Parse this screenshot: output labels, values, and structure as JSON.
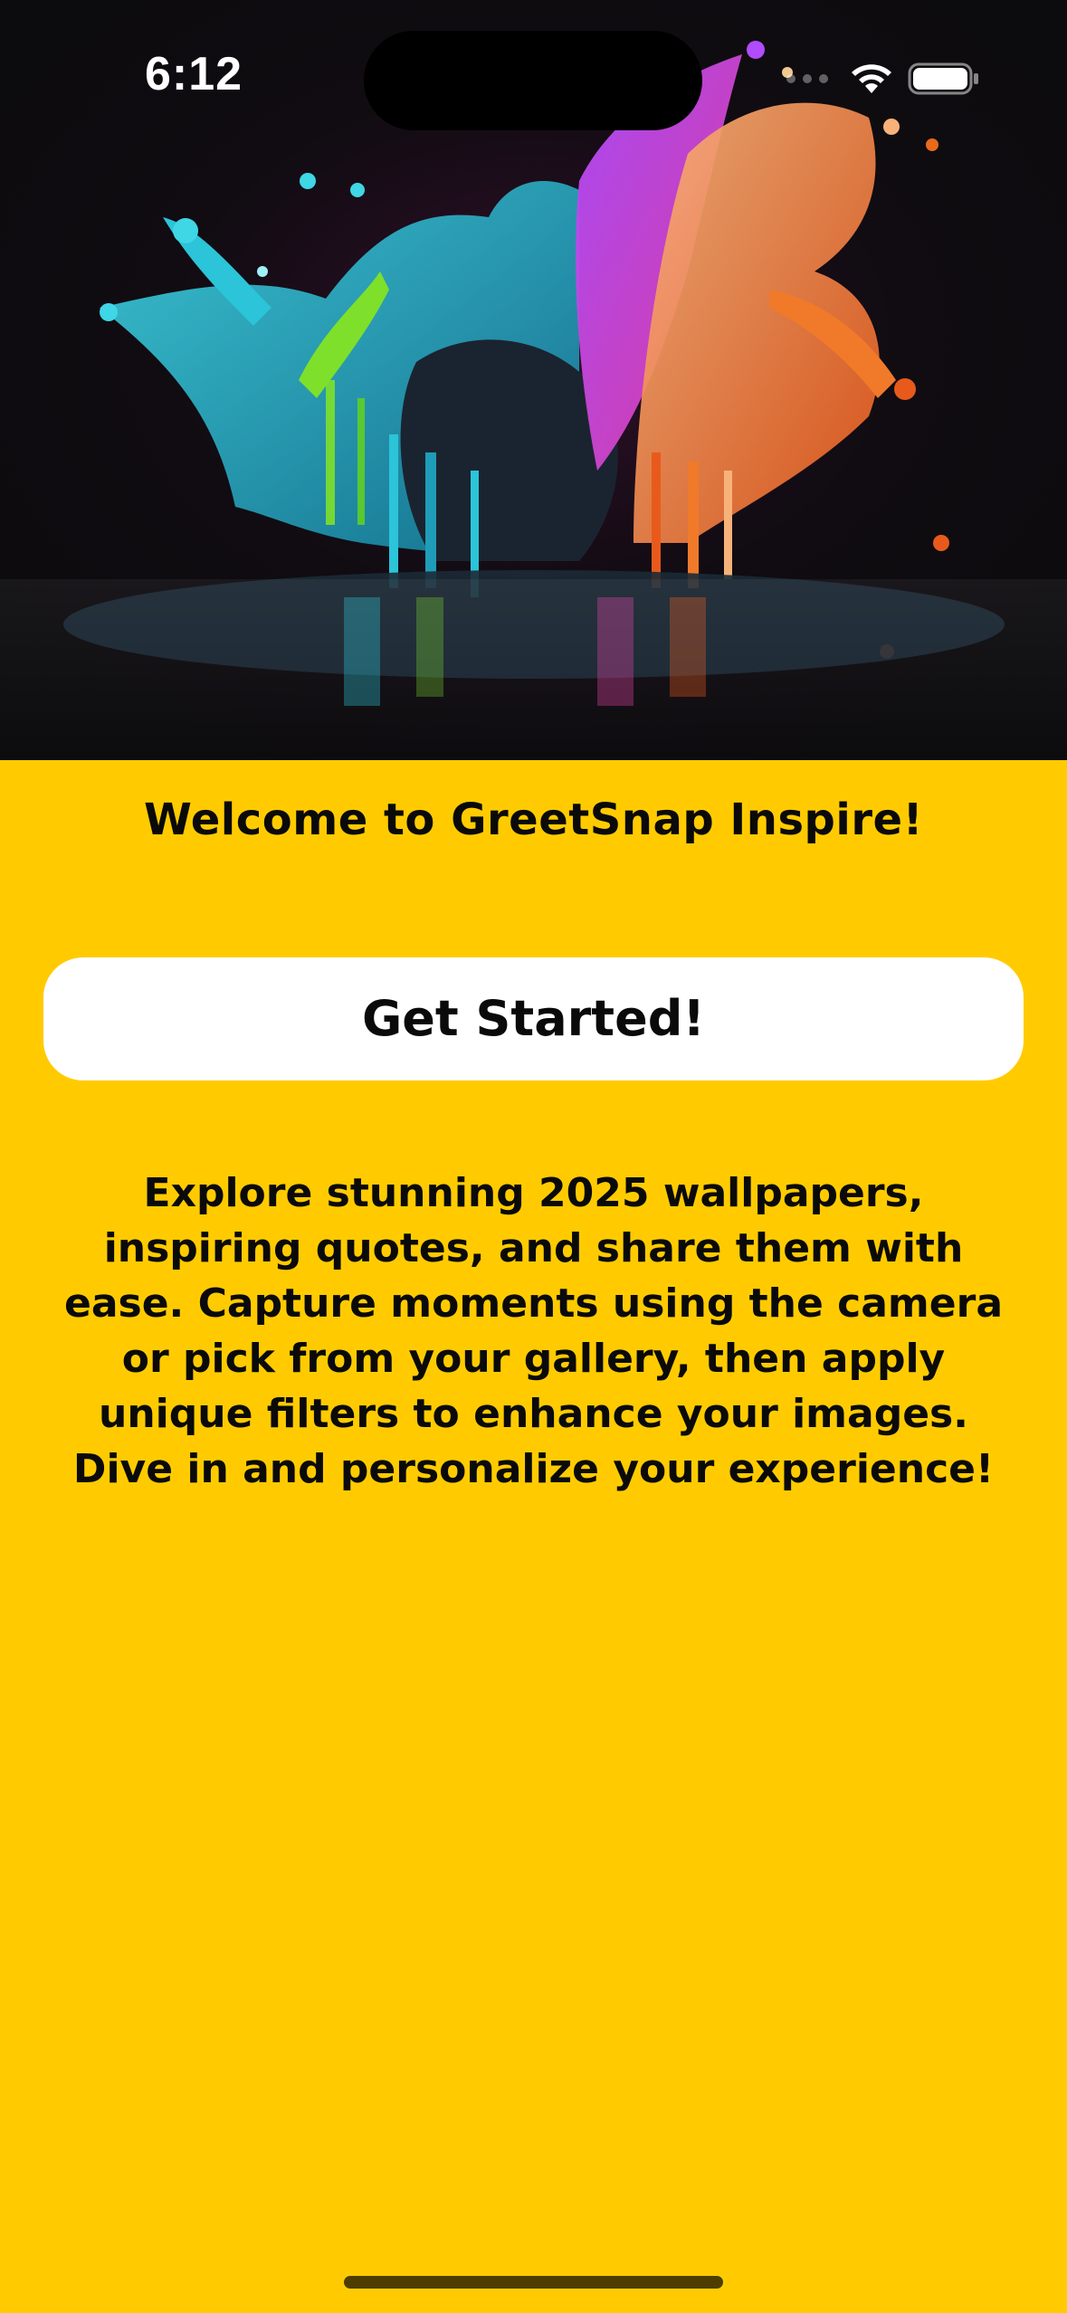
{
  "status_bar": {
    "time": "6:12",
    "icons": [
      "cellular-signal-icon",
      "wifi-icon",
      "battery-icon"
    ]
  },
  "hero": {
    "image": "colorful-paint-splash-artwork"
  },
  "welcome": {
    "title": "Welcome to GreetSnap Inspire!"
  },
  "actions": {
    "get_started_label": "Get Started!"
  },
  "description": {
    "text": "Explore stunning 2025 wallpapers, inspiring quotes, and share them with ease. Capture moments using the camera or pick from your gallery, then apply unique filters to enhance your images. Dive in and personalize your experience!"
  },
  "colors": {
    "background": "#FFCB00",
    "button": "#FFFFFF",
    "text": "#0A0A0A",
    "hero_background": "#0C0B0D"
  }
}
